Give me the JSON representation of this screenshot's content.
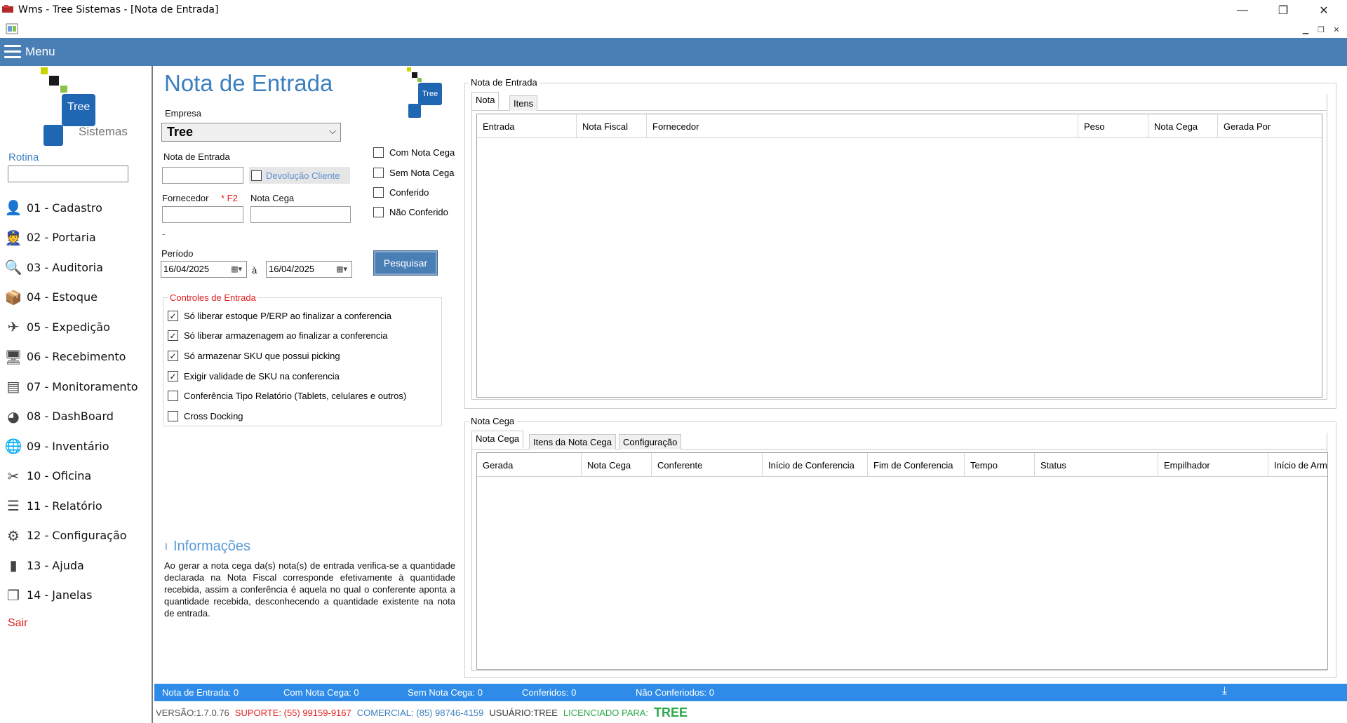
{
  "window": {
    "title": "Wms - Tree Sistemas - [Nota de Entrada]",
    "minimize": "—",
    "restore": "❐",
    "close": "✕"
  },
  "menubar": {
    "label": "Menu"
  },
  "logo": {
    "tree": "Tree",
    "sistemas": "Sistemas"
  },
  "sidebar": {
    "rotina_label": "Rotina",
    "items": [
      {
        "label": "01 - Cadastro",
        "icon": "user-icon"
      },
      {
        "label": "02 - Portaria",
        "icon": "guard-icon"
      },
      {
        "label": "03 - Auditoria",
        "icon": "search-icon"
      },
      {
        "label": "04 - Estoque",
        "icon": "boxes-icon"
      },
      {
        "label": "05 - Expedição",
        "icon": "dispatch-icon"
      },
      {
        "label": "06 - Recebimento",
        "icon": "monitor-icon"
      },
      {
        "label": "07 - Monitoramento",
        "icon": "shelf-icon"
      },
      {
        "label": "08 - DashBoard",
        "icon": "pie-icon"
      },
      {
        "label": "09 - Inventário",
        "icon": "globe-icon"
      },
      {
        "label": "10 - Oficina",
        "icon": "tools-icon"
      },
      {
        "label": "11 - Relatório",
        "icon": "report-icon"
      },
      {
        "label": "12 - Configuração",
        "icon": "gear-icon"
      },
      {
        "label": "13 - Ajuda",
        "icon": "book-icon"
      },
      {
        "label": "14 - Janelas",
        "icon": "windows-icon"
      }
    ],
    "sair": "Sair"
  },
  "form": {
    "title": "Nota de Entrada",
    "empresa_label": "Empresa",
    "empresa_value": "Tree",
    "nota_entrada_label": "Nota de Entrada",
    "devolucao_label": "Devolução Cliente",
    "fornecedor_label": "Fornecedor",
    "fornecedor_hint": "* F2",
    "nota_cega_label": "Nota Cega",
    "dash": "-",
    "periodo_label": "Período",
    "date_from": "16/04/2025",
    "date_sep": "à",
    "date_to": "16/04/2025",
    "pesquisar": "Pesquisar",
    "filters": [
      {
        "label": "Com Nota Cega",
        "checked": false
      },
      {
        "label": "Sem Nota Cega",
        "checked": false
      },
      {
        "label": "Conferido",
        "checked": false
      },
      {
        "label": "Não Conferido",
        "checked": false
      }
    ],
    "controles_title": "Controles de Entrada",
    "controles": [
      {
        "label": "Só liberar estoque P/ERP ao finalizar a conferencia",
        "mark": "✓"
      },
      {
        "label": "Só liberar armazenagem ao finalizar a conferencia",
        "mark": "✓"
      },
      {
        "label": "Só armazenar SKU que possui picking",
        "mark": "✓"
      },
      {
        "label": "Exigir validade de SKU na conferencia",
        "mark": "✓"
      },
      {
        "label": "Conferência Tipo Relatório (Tablets, celulares e outros)",
        "mark": ""
      },
      {
        "label": "Cross Docking",
        "mark": ""
      }
    ],
    "info_bar": "I",
    "info_title": "Informações",
    "info_text": "Ao gerar a nota cega da(s) nota(s) de entrada verifica-se a quantidade declarada na Nota Fiscal corresponde efetivamente à quantidade recebida, assim a conferência é aquela no qual o conferente aponta a quantidade recebida, desconhecendo a quantidade existente na nota de entrada."
  },
  "nota_entrada_group": {
    "title": "Nota de Entrada",
    "tabs": [
      "Nota",
      "Itens"
    ],
    "columns": [
      "Entrada",
      "Nota Fiscal",
      "Fornecedor",
      "Peso",
      "Nota Cega",
      "Gerada Por"
    ]
  },
  "nota_cega_group": {
    "title": "Nota Cega",
    "tabs": [
      "Nota Cega",
      "Itens da Nota Cega",
      "Configuração"
    ],
    "columns": [
      "Gerada",
      "Nota Cega",
      "Conferente",
      "Início de Conferencia",
      "Fim de Conferencia",
      "Tempo",
      "Status",
      "Empilhador",
      "Início de Arm"
    ]
  },
  "statusbar": {
    "nota_entrada": "Nota de Entrada:  0",
    "com_nota_cega": "Com Nota Cega:   0",
    "sem_nota_cega": "Sem Nota Cega:   0",
    "conferidos": "Conferidos:   0",
    "nao_conferidos": "Não Conferiodos:   0",
    "download": "⤓"
  },
  "footer": {
    "versao": "VERSÃO:1.7.0.76",
    "suporte": "SUPORTE:  (55) 99159-9167",
    "comercial": "COMERCIAL: (85) 98746-4159",
    "usuario": "USUÁRIO:TREE",
    "licenciado": "LICENCIADO PARA:",
    "licenciado_nome": "TREE"
  },
  "colors": {
    "accent": "#4a7fb5",
    "title_blue": "#3b7fc0",
    "status_blue": "#2e8ce8",
    "red": "#e02020",
    "green": "#2aa84a"
  }
}
